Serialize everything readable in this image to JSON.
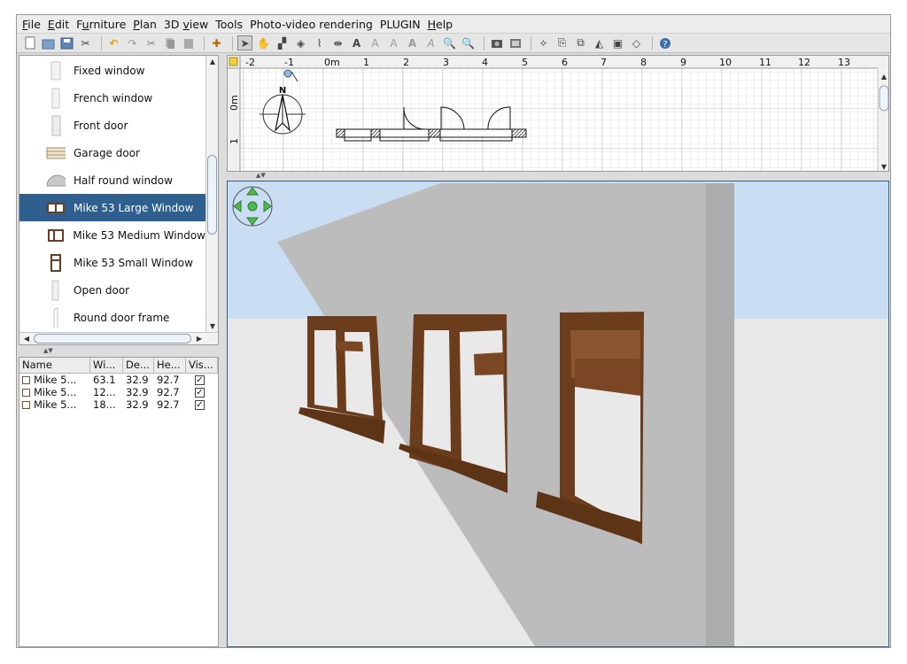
{
  "menu": {
    "items": [
      {
        "label": "File",
        "mnemonic": "F",
        "rest": "ile"
      },
      {
        "label": "Edit",
        "mnemonic": "E",
        "rest": "dit"
      },
      {
        "label": "Furniture",
        "mnemonic": "",
        "pre": "F",
        "u": "u",
        "post": "rniture"
      },
      {
        "label": "Plan",
        "mnemonic": "P",
        "rest": "lan"
      },
      {
        "label": "3D view",
        "pre": "3D ",
        "u": "v",
        "post": "iew"
      },
      {
        "label": "Tools"
      },
      {
        "label": "Photo-video rendering"
      },
      {
        "label": "PLUGIN"
      },
      {
        "label": "Help",
        "mnemonic": "H",
        "rest": "elp"
      }
    ]
  },
  "toolbar": {
    "icons": [
      "new-file-icon",
      "open-file-icon",
      "save-file-icon",
      "preferences-icon",
      "undo-icon",
      "redo-icon",
      "cut-icon",
      "copy-icon",
      "paste-icon",
      "add-furniture-icon",
      "select-mode-icon",
      "pan-mode-icon",
      "create-walls-icon",
      "create-rooms-icon",
      "create-polylines-icon",
      "create-dimensions-icon",
      "add-text-icon",
      "text-style-bold-icon",
      "text-style-italic-icon",
      "increase-text-icon",
      "decrease-text-icon",
      "zoom-in-icon",
      "zoom-out-icon",
      "create-photo-icon",
      "create-video-icon",
      "edit-icon-a",
      "edit-icon-b",
      "edit-icon-c",
      "edit-icon-d",
      "edit-icon-e",
      "edit-icon-f",
      "help-icon"
    ]
  },
  "catalog": {
    "items": [
      {
        "label": "Fixed window",
        "icon": "fixed-window-icon"
      },
      {
        "label": "French window",
        "icon": "french-window-icon"
      },
      {
        "label": "Front door",
        "icon": "front-door-icon"
      },
      {
        "label": "Garage door",
        "icon": "garage-door-icon"
      },
      {
        "label": "Half round window",
        "icon": "half-round-window-icon"
      },
      {
        "label": "Mike 53 Large Window",
        "icon": "large-window-icon",
        "selected": true
      },
      {
        "label": "Mike 53 Medium Window",
        "icon": "medium-window-icon"
      },
      {
        "label": "Mike 53 Small Window",
        "icon": "small-window-icon"
      },
      {
        "label": "Open door",
        "icon": "open-door-icon"
      },
      {
        "label": "Round door frame",
        "icon": "round-door-frame-icon"
      }
    ]
  },
  "furniture_table": {
    "headers": [
      "Name",
      "Wi...",
      "De...",
      "He...",
      "Vis..."
    ],
    "rows": [
      {
        "name": "Mike 5...",
        "width": "63.1",
        "depth": "32.9",
        "height": "92.7",
        "visible": true
      },
      {
        "name": "Mike 5...",
        "width": "12...",
        "depth": "32.9",
        "height": "92.7",
        "visible": true
      },
      {
        "name": "Mike 5...",
        "width": "18...",
        "depth": "32.9",
        "height": "92.7",
        "visible": true
      }
    ]
  },
  "plan": {
    "ruler_x": [
      "-2",
      "-1",
      "0m",
      "1",
      "2",
      "3",
      "4",
      "5",
      "6",
      "7",
      "8",
      "9",
      "10",
      "11",
      "12",
      "13"
    ],
    "ruler_y": [
      "0m",
      "1"
    ],
    "compass_label": "N"
  },
  "colors": {
    "selection": "#2f5f8e",
    "sky": "#c9ddf3",
    "ground": "#e8e8e8",
    "wall": "#bfbfbf",
    "wood": "#6b3d1c"
  }
}
